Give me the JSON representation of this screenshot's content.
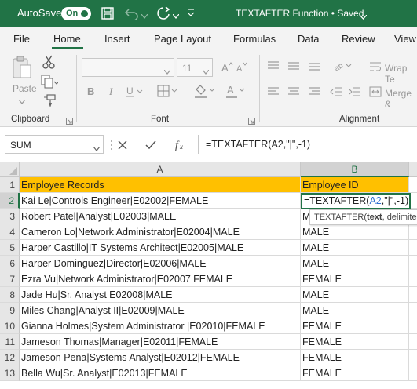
{
  "titlebar": {
    "autosave_label": "AutoSave",
    "autosave_state": "On",
    "doc_title": "TEXTAFTER Function • Saved"
  },
  "tabs": [
    "File",
    "Home",
    "Insert",
    "Page Layout",
    "Formulas",
    "Data",
    "Review",
    "View"
  ],
  "ribbon": {
    "clipboard_label": "Clipboard",
    "paste_label": "Paste",
    "font_label": "Font",
    "font_size": "11",
    "alignment_label": "Alignment",
    "wrap_text": "Wrap Te",
    "merge": "Merge &"
  },
  "formula_bar": {
    "name_box": "SUM",
    "formula": "=TEXTAFTER(A2,\"|\",-1)"
  },
  "grid": {
    "columns": [
      "A",
      "B"
    ],
    "rows": [
      {
        "num": "1",
        "a": "Employee Records",
        "b": "Employee ID"
      },
      {
        "num": "2",
        "a": "Kai Le|Controls Engineer|E02002|FEMALE",
        "b": ""
      },
      {
        "num": "3",
        "a": "Robert Patel|Analyst|E02003|MALE",
        "b": "M"
      },
      {
        "num": "4",
        "a": "Cameron Lo|Network Administrator|E02004|MALE",
        "b": "MALE"
      },
      {
        "num": "5",
        "a": "Harper Castillo|IT Systems Architect|E02005|MALE",
        "b": "MALE"
      },
      {
        "num": "6",
        "a": "Harper Dominguez|Director|E02006|MALE",
        "b": "MALE"
      },
      {
        "num": "7",
        "a": "Ezra Vu|Network Administrator|E02007|FEMALE",
        "b": "FEMALE"
      },
      {
        "num": "8",
        "a": "Jade Hu|Sr. Analyst|E02008|MALE",
        "b": "MALE"
      },
      {
        "num": "9",
        "a": "Miles Chang|Analyst II|E02009|MALE",
        "b": "MALE"
      },
      {
        "num": "10",
        "a": "Gianna Holmes|System Administrator |E02010|FEMALE",
        "b": "FEMALE"
      },
      {
        "num": "11",
        "a": "Jameson Thomas|Manager|E02011|FEMALE",
        "b": "FEMALE"
      },
      {
        "num": "12",
        "a": "Jameson Pena|Systems Analyst|E02012|FEMALE",
        "b": "FEMALE"
      },
      {
        "num": "13",
        "a": "Bella Wu|Sr. Analyst|E02013|FEMALE",
        "b": "FEMALE"
      }
    ],
    "editing_cell": {
      "prefix": "=TEXTAFTER(",
      "ref": "A2",
      "suffix": ",\"|\",-1)"
    },
    "tooltip": {
      "fn": "TEXTAFTER(",
      "arg1": "text",
      "rest": ", delimite"
    }
  },
  "colors": {
    "accent": "#217346",
    "header_fill": "#ffc000",
    "reference": "#2f6fd1"
  }
}
